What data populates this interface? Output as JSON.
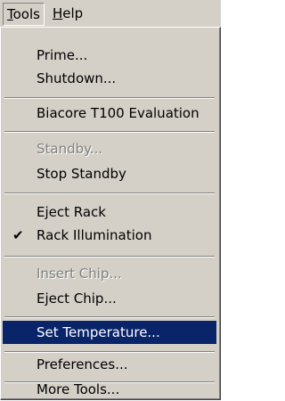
{
  "menubar": {
    "tools": {
      "underline": "T",
      "rest": "ools"
    },
    "help": {
      "underline": "H",
      "rest": "elp"
    }
  },
  "menu": {
    "prime": "Prime...",
    "shutdown": "Shutdown...",
    "biacore_eval": "Biacore T100 Evaluation",
    "standby": "Standby...",
    "stop_standby": "Stop Standby",
    "eject_rack": "Eject Rack",
    "rack_illumination": "Rack Illumination",
    "rack_illumination_checked": "✔",
    "insert_chip": "Insert Chip...",
    "eject_chip": "Eject Chip...",
    "set_temperature": "Set Temperature...",
    "preferences": "Preferences...",
    "more_tools": "More Tools..."
  },
  "colors": {
    "menu_face": "#d4d0c8",
    "highlight": "#0a246a",
    "disabled_text": "#808080"
  }
}
